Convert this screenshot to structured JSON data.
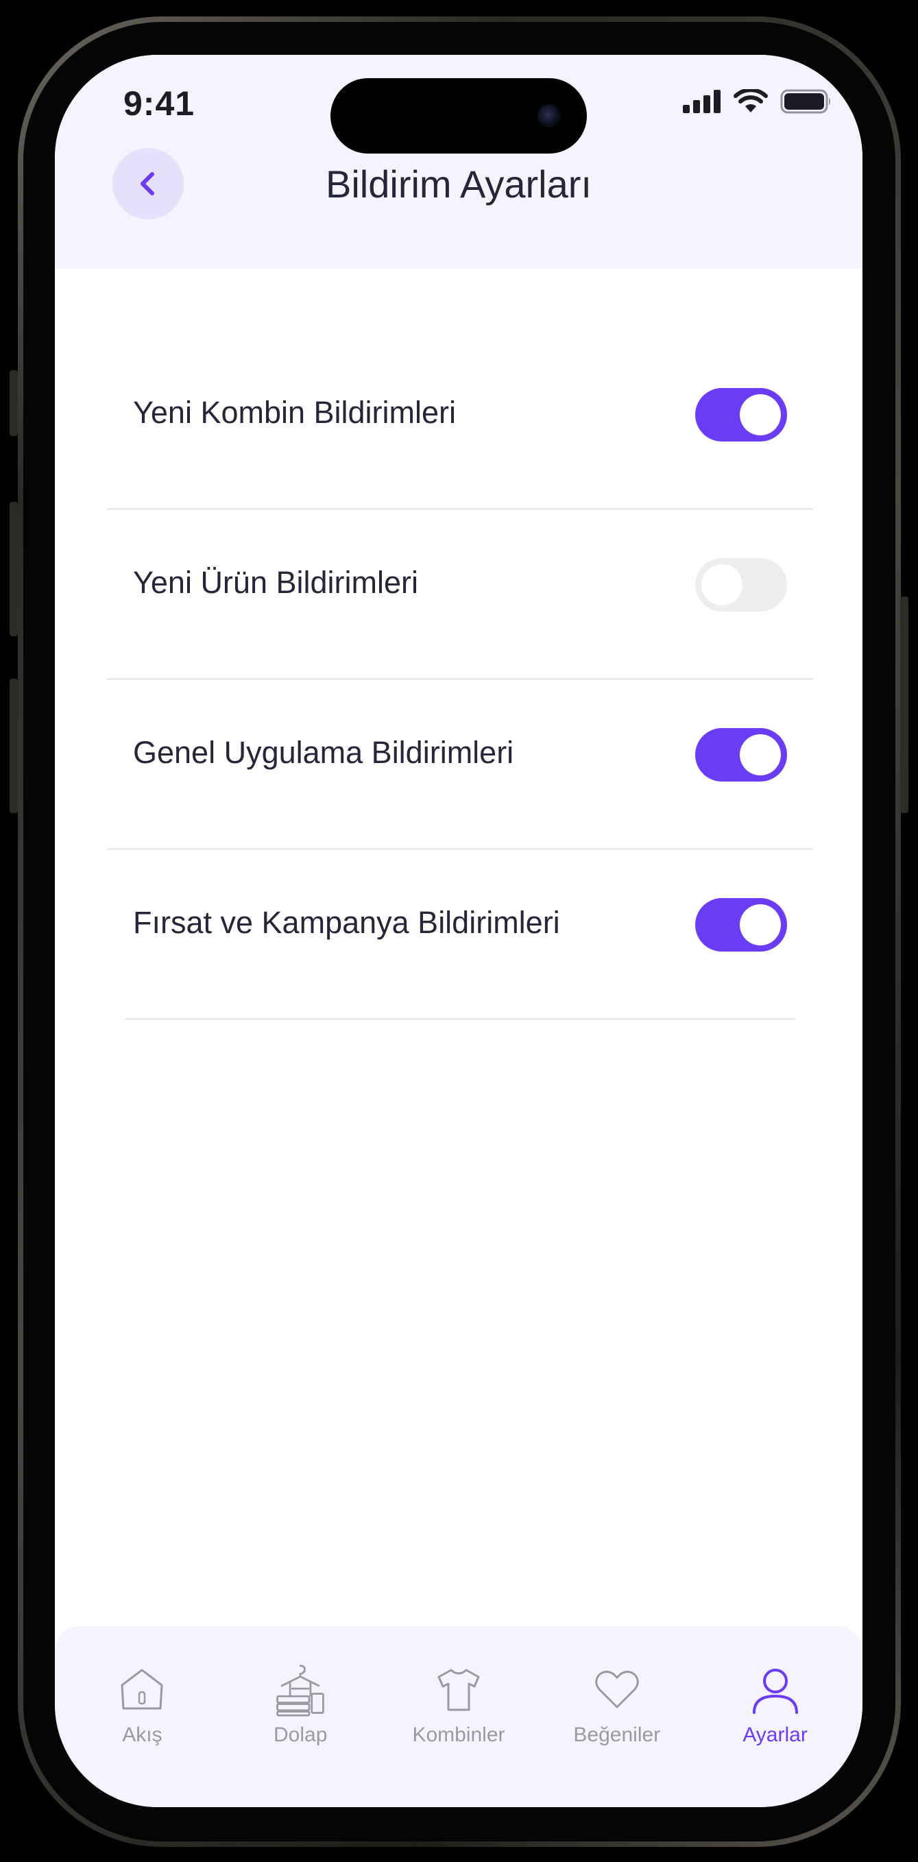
{
  "status_bar": {
    "time": "9:41"
  },
  "header": {
    "title": "Bildirim Ayarları",
    "back_icon": "chevron-left-icon"
  },
  "colors": {
    "accent": "#6a3cf5",
    "header_bg": "#f5f3fe",
    "toggle_off": "#eeeef0",
    "text": "#26263a",
    "tab_inactive": "#9a9aa6"
  },
  "settings": [
    {
      "label": "Yeni Kombin Bildirimleri",
      "enabled": true
    },
    {
      "label": "Yeni Ürün Bildirimleri",
      "enabled": false
    },
    {
      "label": "Genel Uygulama Bildirimleri",
      "enabled": true
    },
    {
      "label": "Fırsat ve Kampanya Bildirimleri",
      "enabled": true
    }
  ],
  "tabbar": {
    "items": [
      {
        "label": "Akış",
        "icon": "home-icon",
        "active": false
      },
      {
        "label": "Dolap",
        "icon": "wardrobe-icon",
        "active": false
      },
      {
        "label": "Kombinler",
        "icon": "tshirt-icon",
        "active": false
      },
      {
        "label": "Beğeniler",
        "icon": "heart-icon",
        "active": false
      },
      {
        "label": "Ayarlar",
        "icon": "user-icon",
        "active": true
      }
    ]
  }
}
